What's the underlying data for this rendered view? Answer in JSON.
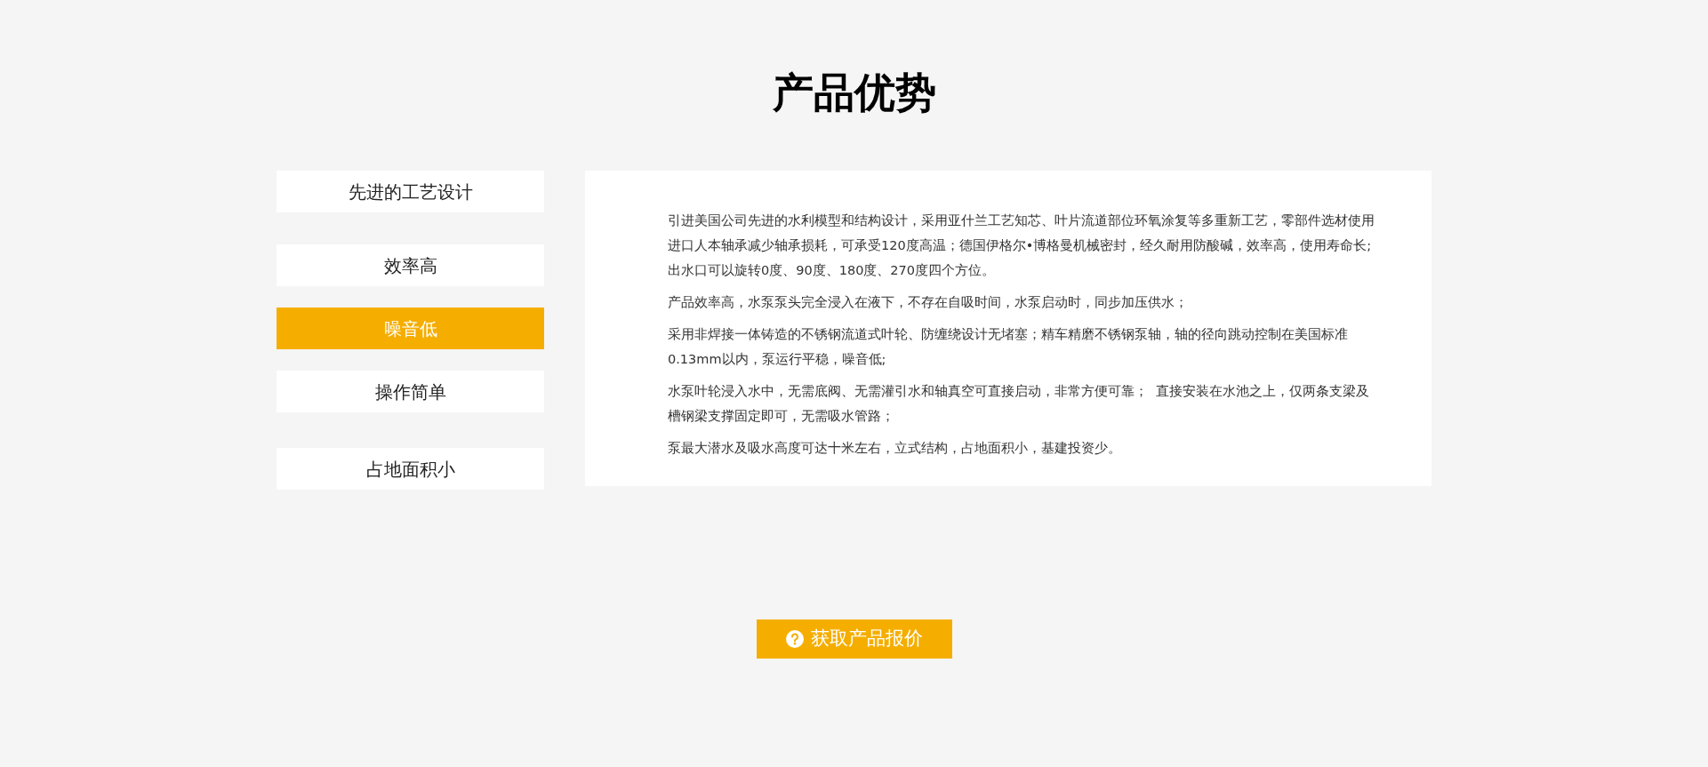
{
  "title": "产品优势",
  "tabs": [
    {
      "label": "先进的工艺设计",
      "selected": false
    },
    {
      "label": "效率高",
      "selected": false
    },
    {
      "label": "噪音低",
      "selected": true
    },
    {
      "label": "操作简单",
      "selected": false
    },
    {
      "label": "占地面积小",
      "selected": false
    }
  ],
  "paragraphs": [
    "引进美国公司先进的水利模型和结构设计，采用亚什兰工艺知芯、叶片流道部位环氧涂复等多重新工艺，零部件选材使用进口人本轴承减少轴承损耗，可承受120度高温；德国伊格尔•博格曼机械密封，经久耐用防酸碱，效率高，使用寿命长;出水口可以旋转0度、90度、180度、270度四个方位。",
    "产品效率高，水泵泵头完全浸入在液下，不存在自吸时间，水泵启动时，同步加压供水；",
    "采用非焊接一体铸造的不锈钢流道式叶轮、防缠绕设计无堵塞；精车精磨不锈钢泵轴，轴的径向跳动控制在美国标准0.13mm以内，泵运行平稳，噪音低;",
    "水泵叶轮浸入水中，无需底阀、无需灌引水和轴真空可直接启动，非常方便可靠；  直接安装在水池之上，仅两条支梁及槽钢梁支撑固定即可，无需吸水管路；",
    "泵最大潜水及吸水高度可达十米左右，立式结构，占地面积小，基建投资少。"
  ],
  "quote_button": {
    "label": "获取产品报价"
  }
}
